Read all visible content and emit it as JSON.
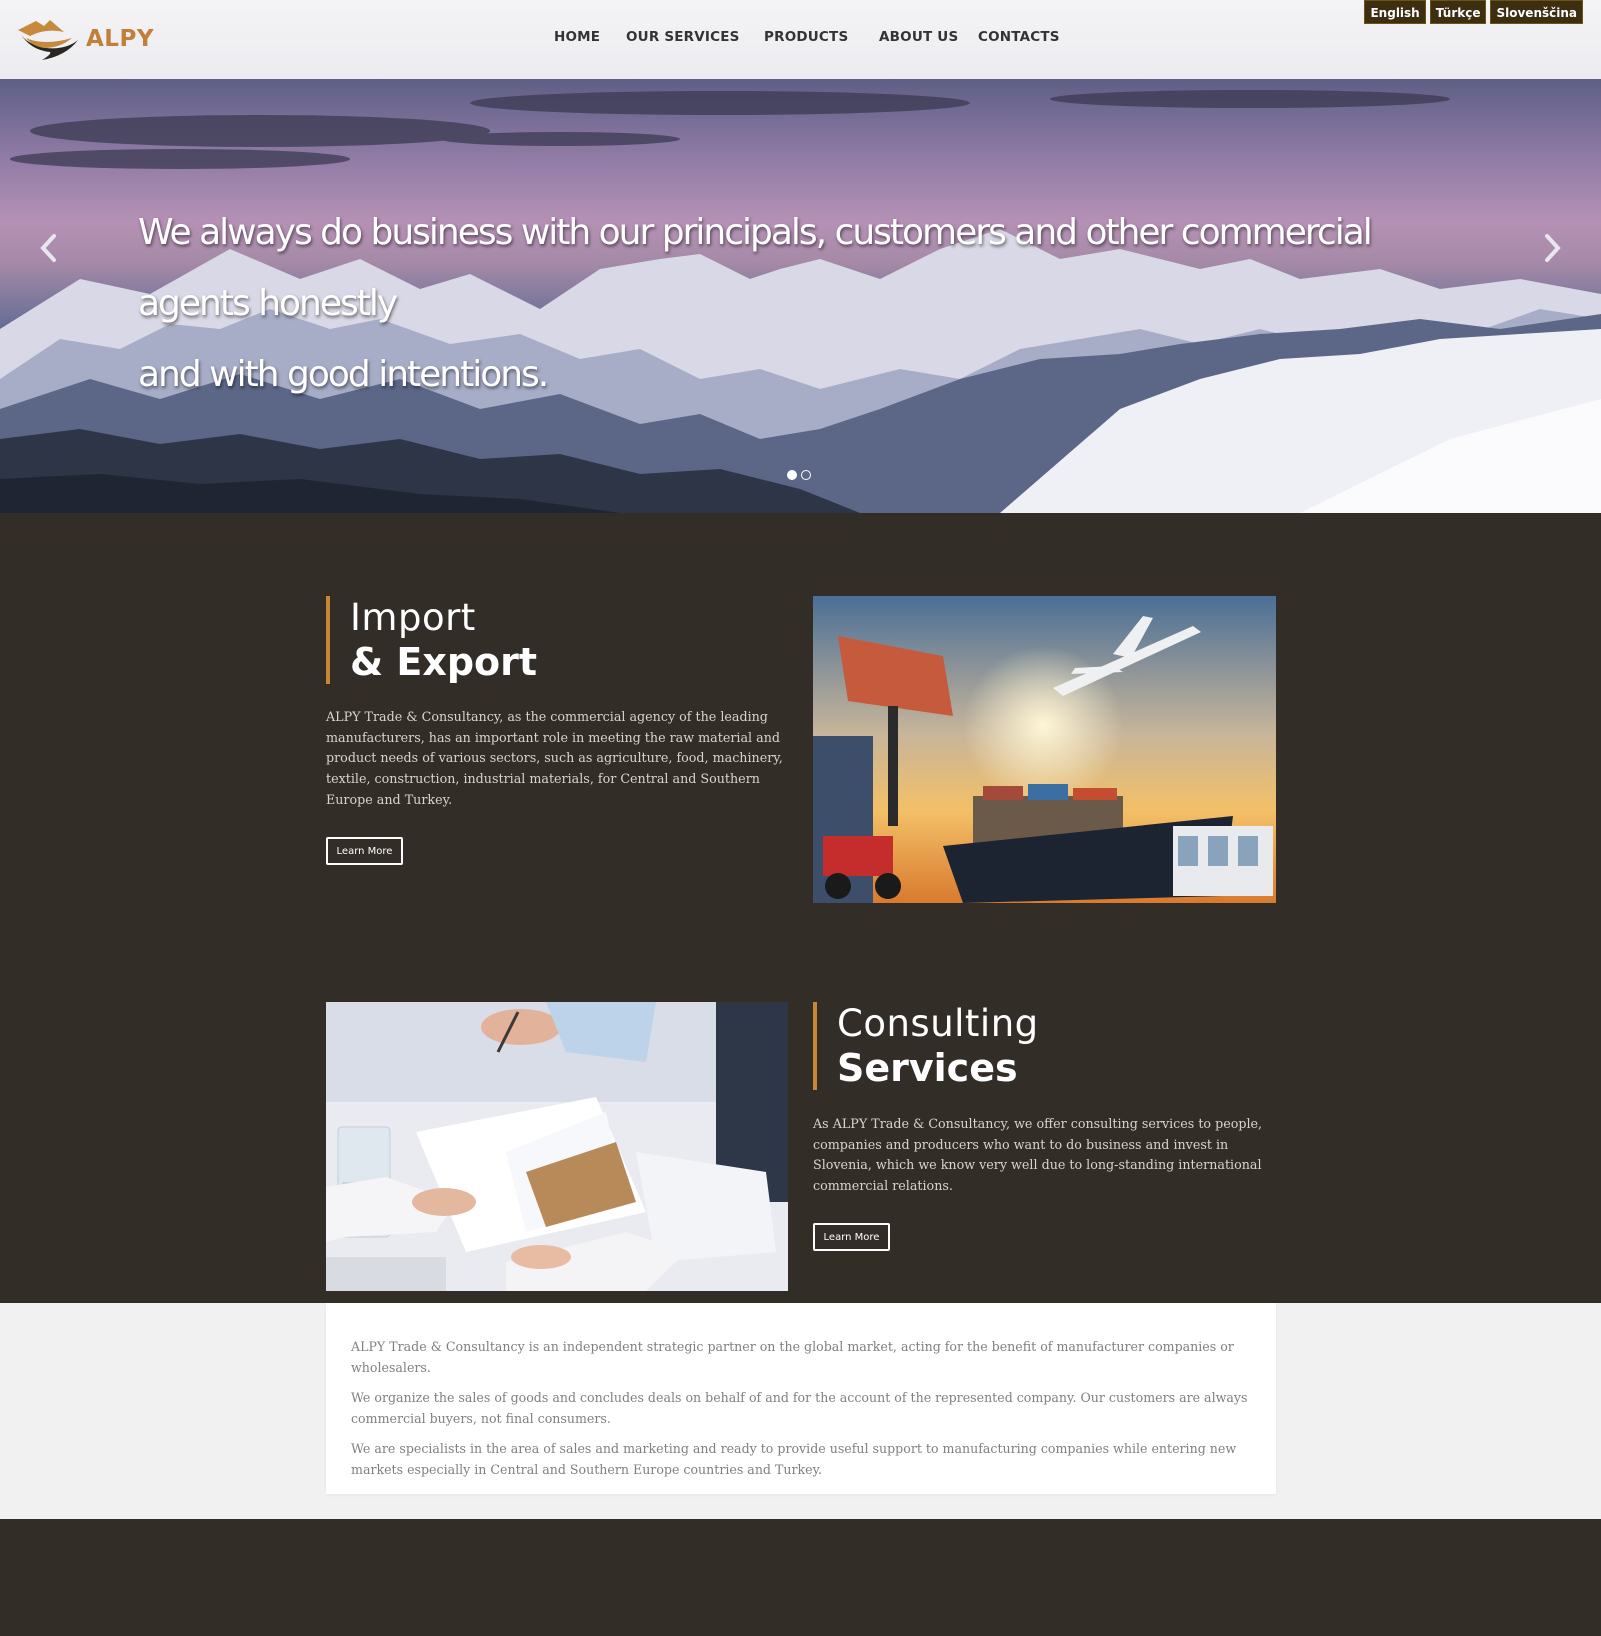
{
  "brand": {
    "name": "ALPY",
    "accent": "#c17f3a",
    "background": "#332d28"
  },
  "nav": {
    "items": [
      {
        "label": "HOME"
      },
      {
        "label": "OUR SERVICES"
      },
      {
        "label": "PRODUCTS"
      },
      {
        "label": "ABOUT US"
      },
      {
        "label": "CONTACTS"
      }
    ]
  },
  "languages": [
    "English",
    "Türkçe",
    "Slovenščina"
  ],
  "hero": {
    "slides_count": 2,
    "active_slide": 1,
    "lines": [
      "We always do business with our principals, customers and other commercial agents honestly",
      "and with good intentions."
    ],
    "prev_icon": "chevron-left-icon",
    "next_icon": "chevron-right-icon"
  },
  "features": [
    {
      "title_light": "Import",
      "title_bold": "& Export",
      "body": "ALPY Trade & Consultancy, as the commercial agency of the leading manufacturers, has an important role in meeting the raw material and product needs of various sectors, such as agriculture, food, machinery, textile, construction, industrial materials, for Central and Southern Europe and Turkey.",
      "button": "Learn More",
      "image": "cargo-ship-airplane-photo"
    },
    {
      "title_light": "Consulting",
      "title_bold": "Services",
      "body": "As ALPY Trade & Consultancy, we offer consulting services to people, companies and producers who want to do business and invest in Slovenia, which we know very well due to long-standing international commercial relations.",
      "button": "Learn More",
      "image": "business-meeting-documents-photo"
    }
  ],
  "about": {
    "paragraphs": [
      "ALPY Trade & Consultancy is an independent strategic partner on the global market, acting for the benefit of manufacturer companies or wholesalers.",
      "We organize the sales of goods and concludes deals on behalf of and for the account of the represented company. Our customers are always commercial buyers, not final consumers.",
      "We are specialists in the area of sales and marketing and ready to provide useful support to manufacturing companies while entering new markets especially in Central and Southern Europe countries and Turkey."
    ]
  }
}
